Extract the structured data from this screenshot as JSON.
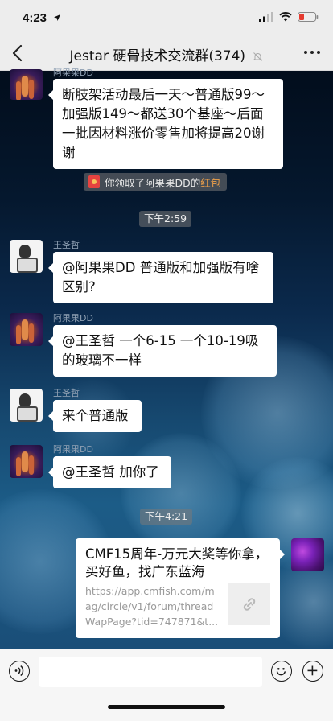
{
  "status_bar": {
    "time": "4:23"
  },
  "header": {
    "title": "Jestar 硬骨技术交流群(374)"
  },
  "messages": [
    {
      "sender": "阿果果DD",
      "text": "断肢架活动最后一天～普通版99～加强版149～都送30个基座～后面一批因材料涨价零售加将提高20谢谢"
    },
    {
      "sender": "王圣哲",
      "text": "@阿果果DD 普通版和加强版有啥区别?"
    },
    {
      "sender": "阿果果DD",
      "text": "@王圣哲 一个6-15 一个10-19吸的玻璃不一样"
    },
    {
      "sender": "王圣哲",
      "text": "来个普通版"
    },
    {
      "sender": "阿果果DD",
      "text": "@王圣哲 加你了"
    }
  ],
  "system_notice": {
    "prefix": "你领取了阿果果DD的",
    "link": "红包"
  },
  "timestamps": [
    "下午2:59",
    "下午4:21"
  ],
  "link_card": {
    "title": "CMF15周年-万元大奖等你拿，买好鱼，找广东蓝海",
    "url": "https://app.cmfish.com/mag/circle/v1/forum/threadWapPage?tid=747871&t..."
  },
  "input": {
    "placeholder": ""
  },
  "icons": {
    "voice": "voice-icon",
    "emoji": "emoji-icon",
    "plus": "plus-icon",
    "mute": "mute-bell-icon",
    "more": "more-dots-icon",
    "back": "back-chevron-icon",
    "link": "link-icon"
  }
}
